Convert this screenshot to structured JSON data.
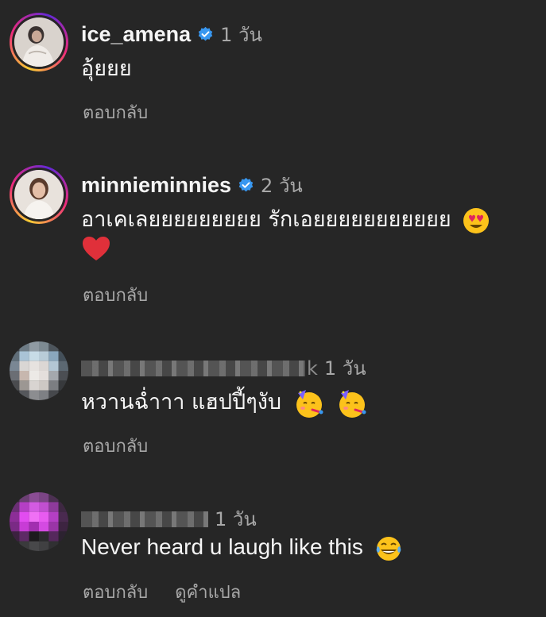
{
  "comments": [
    {
      "username": "ice_amena",
      "verified": true,
      "time": "1 วัน",
      "text": "อุ้ยยย",
      "reply": "ตอบกลับ"
    },
    {
      "username": "minnieminnies",
      "verified": true,
      "time": "2 วัน",
      "text": "อาเคเลยยยยยยยยย รักเอยยยยยยยยยยย",
      "reply": "ตอบกลับ"
    },
    {
      "username_suffix": "k",
      "time": "1 วัน",
      "text": "หวานฉ่ำาา แฮปปี้ๆงับ",
      "reply": "ตอบกลับ"
    },
    {
      "time": "1 วัน",
      "text": "Never heard u laugh like this",
      "reply": "ตอบกลับ",
      "translate": "ดูคำแปล"
    }
  ],
  "icons": {
    "verified": "verified-badge-icon",
    "heart_eyes": "heart-eyes-emoji",
    "red_heart": "red-heart-emoji",
    "party_face": "partying-face-emoji",
    "laughing": "tears-of-joy-emoji"
  },
  "colors": {
    "background": "#262626",
    "primary_text": "#f5f5f5",
    "secondary_text": "#a8a8a8",
    "verified_blue": "#3897f0"
  }
}
